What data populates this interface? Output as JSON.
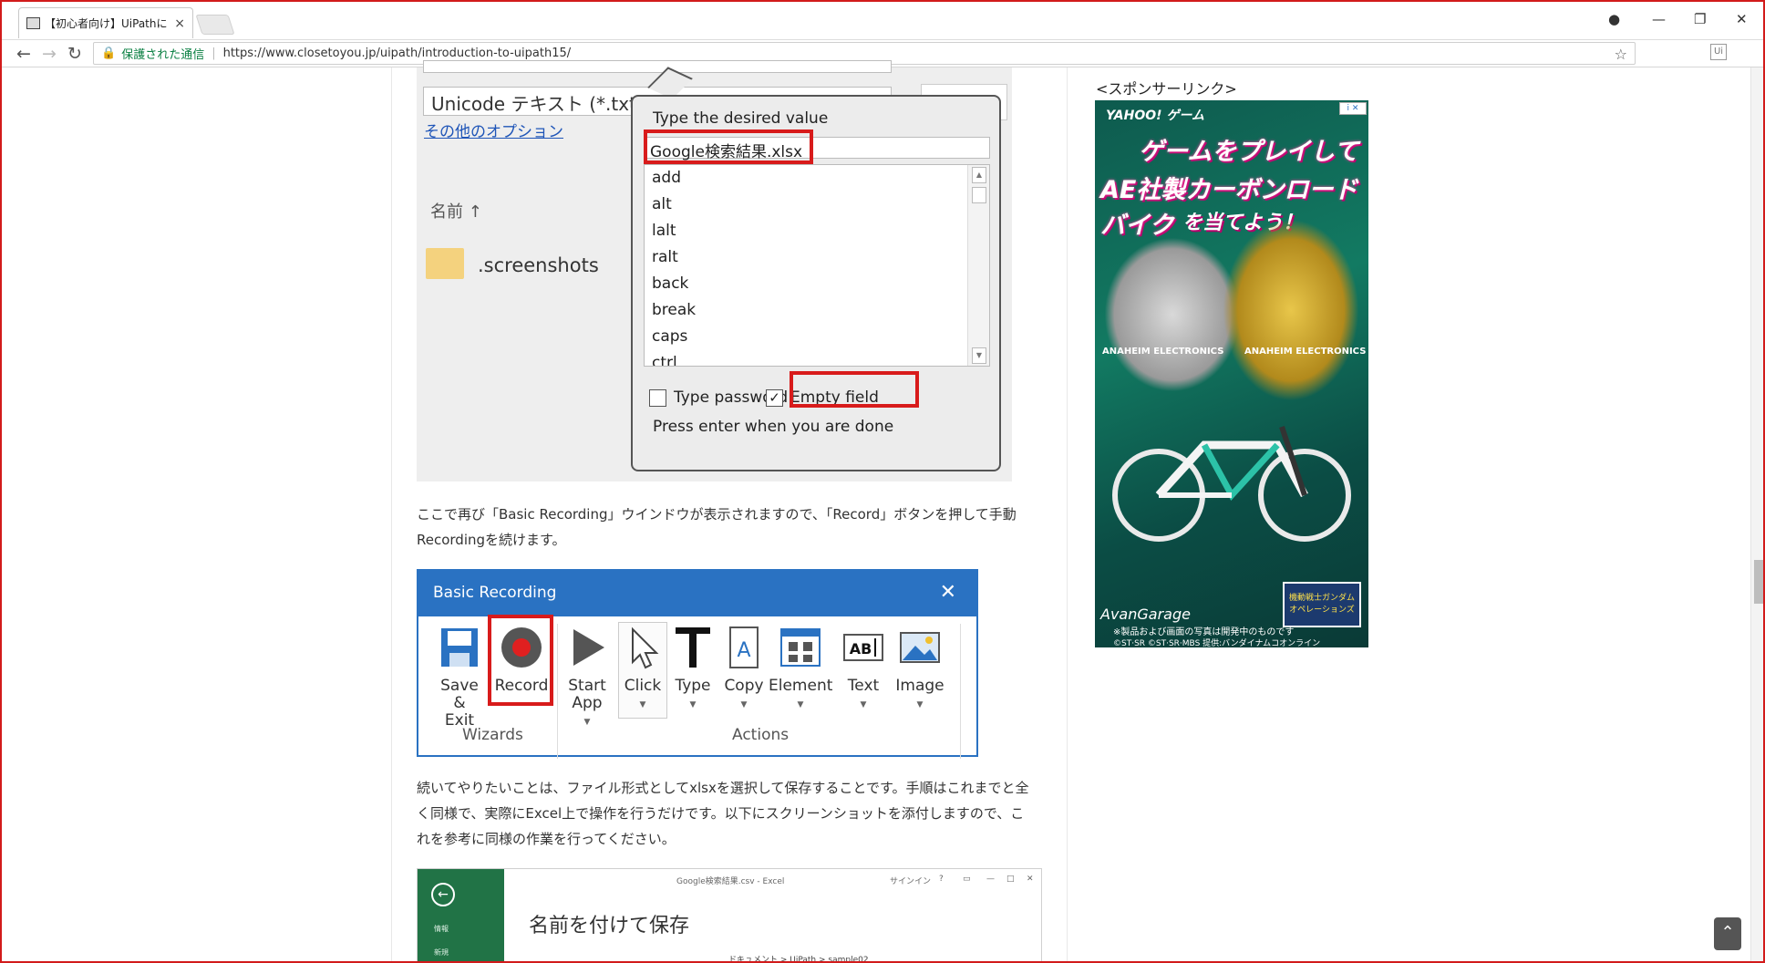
{
  "browser": {
    "tab_title": "【初心者向け】UiPathによる",
    "address_secure": "保護された通信",
    "url": "https://www.closetoyou.jp/uipath/introduction-to-uipath15/",
    "ext_label": "Ui"
  },
  "save_dialog": {
    "filetype": "Unicode テキスト (*.txt)",
    "more_options": "その他のオプション",
    "column_name": "名前 ↑",
    "folder": ".screenshots"
  },
  "type_popup": {
    "title": "Type the desired value",
    "value": "Google検索結果.xlsx",
    "keys": [
      "add",
      "alt",
      "lalt",
      "ralt",
      "back",
      "break",
      "caps",
      "ctrl"
    ],
    "type_password": "Type password",
    "empty_field": "Empty field",
    "footer": "Press enter when you are done"
  },
  "article": {
    "para1": "ここで再び「Basic Recording」ウインドウが表示されますので、「Record」ボタンを押して手動Recordingを続けます。",
    "para2": "続いてやりたいことは、ファイル形式としてxlsxを選択して保存することです。手順はこれまでと全く同様で、実際にExcel上で操作を行うだけです。以下にスクリーンショットを添付しますので、これを参考に同様の作業を行ってください。"
  },
  "basic_recording": {
    "title": "Basic Recording",
    "save_exit": "Save & Exit",
    "record": "Record",
    "start_app": "Start App",
    "click": "Click",
    "type": "Type",
    "copy": "Copy",
    "element": "Element",
    "text": "Text",
    "image": "Image",
    "group_wizards": "Wizards",
    "group_actions": "Actions"
  },
  "excel": {
    "window_title": "Google検索結果.csv - Excel",
    "signin": "サインイン",
    "menu_info": "情報",
    "menu_new": "新規",
    "heading": "名前を付けて保存",
    "path": "ドキュメント > UiPath > sample02"
  },
  "sidebar": {
    "sponsor_label": "<スポンサーリンク>",
    "ad": {
      "logo": "YAHOO! ゲーム",
      "headline1": "ゲームをプレイして",
      "headline2": "AE社製カーボンロードバイク",
      "headline3": "を当てよう！",
      "brand": "ANAHEIM ELECTRONICS",
      "brand_garage": "AvanGarage",
      "note1": "※製品および画面の写真は開発中のものです",
      "note2": "©ST·SR ©ST·SR·MBS 提供:バンダイナムコオンライン",
      "game": "機動戦士ガンダム オペレーションズ",
      "badge": "i ✕"
    }
  },
  "accent": {
    "red": "#d81b1b",
    "blue": "#2a72c2",
    "excel_green": "#217346"
  }
}
